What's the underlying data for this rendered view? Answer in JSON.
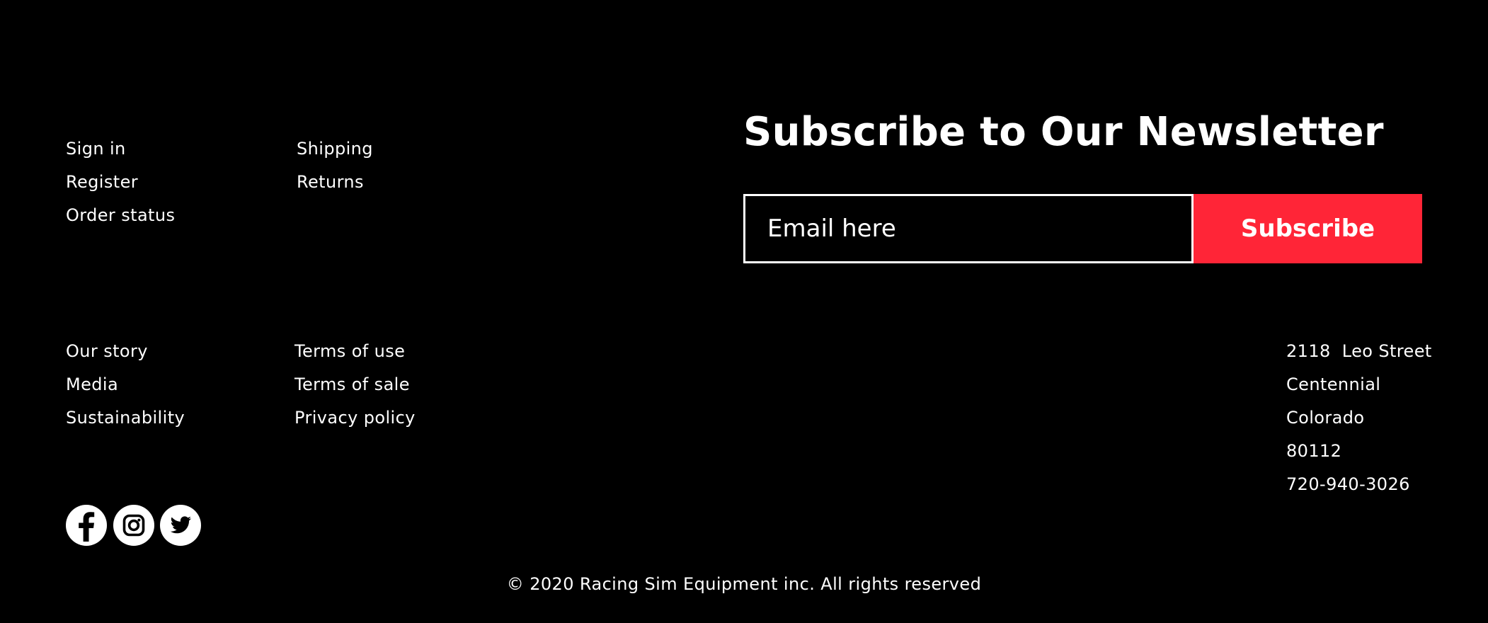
{
  "footer": {
    "account_links": [
      "Sign in",
      "Register",
      "Order status"
    ],
    "service_links": [
      "Shipping",
      "Returns"
    ],
    "about_links": [
      "Our story",
      "Media",
      "Sustainability"
    ],
    "legal_links": [
      "Terms of use",
      "Terms of sale",
      "Privacy policy"
    ]
  },
  "newsletter": {
    "heading": "Subscribe to Our Newsletter",
    "email_placeholder": "Email here",
    "email_value": "",
    "subscribe_label": "Subscribe"
  },
  "address": {
    "street": "2118  Leo Street",
    "city": "Centennial",
    "state": "Colorado",
    "zip": "80112",
    "phone": "720-940-3026"
  },
  "social": [
    {
      "icon": "facebook-icon"
    },
    {
      "icon": "instagram-icon"
    },
    {
      "icon": "twitter-icon"
    }
  ],
  "copyright": "© 2020 Racing Sim Equipment inc. All rights reserved",
  "colors": {
    "background": "#000000",
    "text": "#ffffff",
    "accent": "#ff2537"
  }
}
